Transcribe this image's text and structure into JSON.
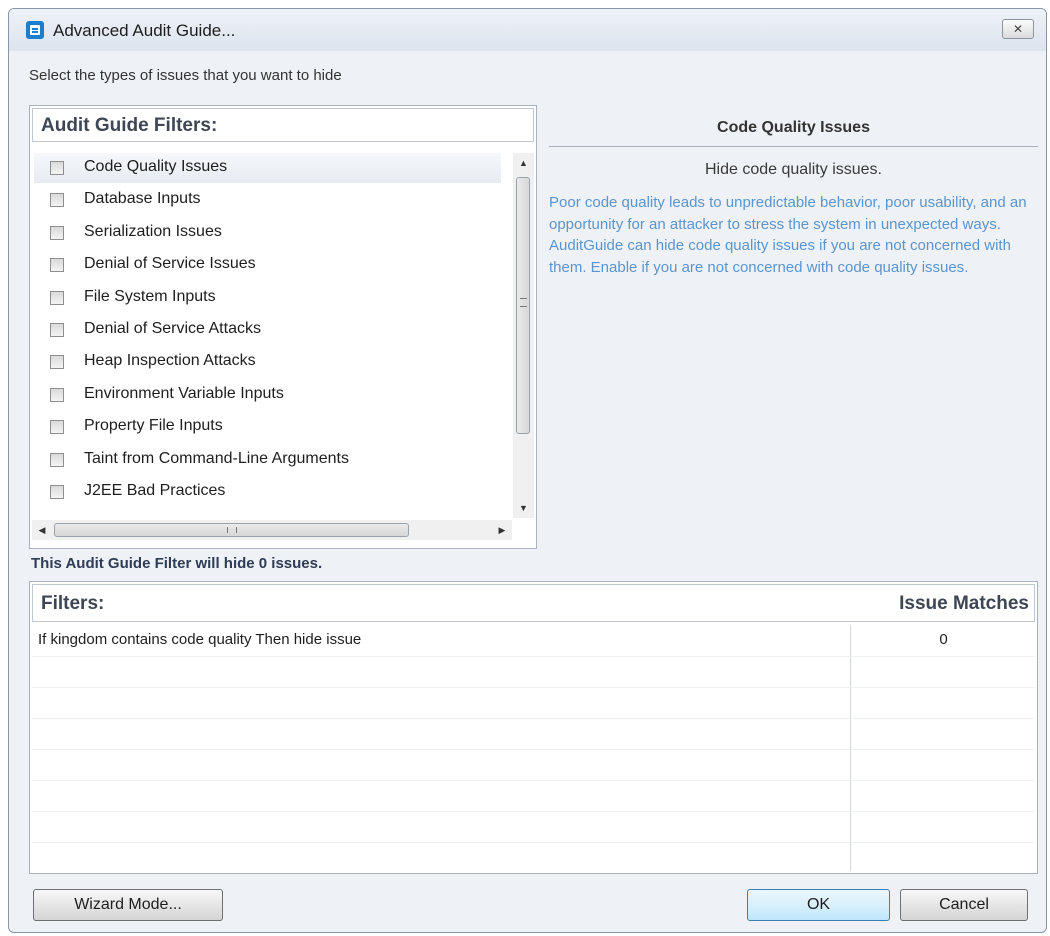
{
  "window": {
    "title": "Advanced Audit Guide...",
    "close_glyph": "✕"
  },
  "instruction": "Select the types of issues that you want to hide",
  "filters_panel": {
    "header": "Audit Guide Filters:",
    "selected_index": 0,
    "items": [
      {
        "label": "Code Quality Issues",
        "checked": false
      },
      {
        "label": "Database Inputs",
        "checked": false
      },
      {
        "label": "Serialization Issues",
        "checked": false
      },
      {
        "label": "Denial of Service Issues",
        "checked": false
      },
      {
        "label": "File System Inputs",
        "checked": false
      },
      {
        "label": "Denial of Service Attacks",
        "checked": false
      },
      {
        "label": "Heap Inspection Attacks",
        "checked": false
      },
      {
        "label": "Environment Variable Inputs",
        "checked": false
      },
      {
        "label": "Property File Inputs",
        "checked": false
      },
      {
        "label": "Taint from Command-Line Arguments",
        "checked": false
      },
      {
        "label": "J2EE Bad Practices",
        "checked": false
      }
    ],
    "scroll_up_glyph": "▲",
    "scroll_down_glyph": "▼",
    "scroll_left_glyph": "◀",
    "scroll_right_glyph": "▶"
  },
  "description": {
    "title": "Code Quality Issues",
    "subtitle": "Hide code quality issues.",
    "body": "Poor code quality leads to unpredictable behavior, poor usability, and an opportunity for an attacker to stress the system in unexpected ways. AuditGuide can hide code quality issues if you are not concerned with them. Enable if you are not concerned with code quality issues."
  },
  "hide_count_text": "This Audit Guide Filter will hide 0 issues.",
  "results": {
    "col_filters": "Filters:",
    "col_matches": "Issue Matches",
    "rows": [
      {
        "filter": "If kingdom contains code quality Then hide issue",
        "matches": "0"
      },
      {
        "filter": "",
        "matches": ""
      },
      {
        "filter": "",
        "matches": ""
      },
      {
        "filter": "",
        "matches": ""
      },
      {
        "filter": "",
        "matches": ""
      },
      {
        "filter": "",
        "matches": ""
      },
      {
        "filter": "",
        "matches": ""
      },
      {
        "filter": "",
        "matches": ""
      }
    ]
  },
  "buttons": {
    "wizard": "Wizard Mode...",
    "ok": "OK",
    "cancel": "Cancel"
  },
  "colors": {
    "description_text": "#5a95cf",
    "ok_button_border": "#3c7fb1",
    "window_background": "#eef1f5"
  }
}
